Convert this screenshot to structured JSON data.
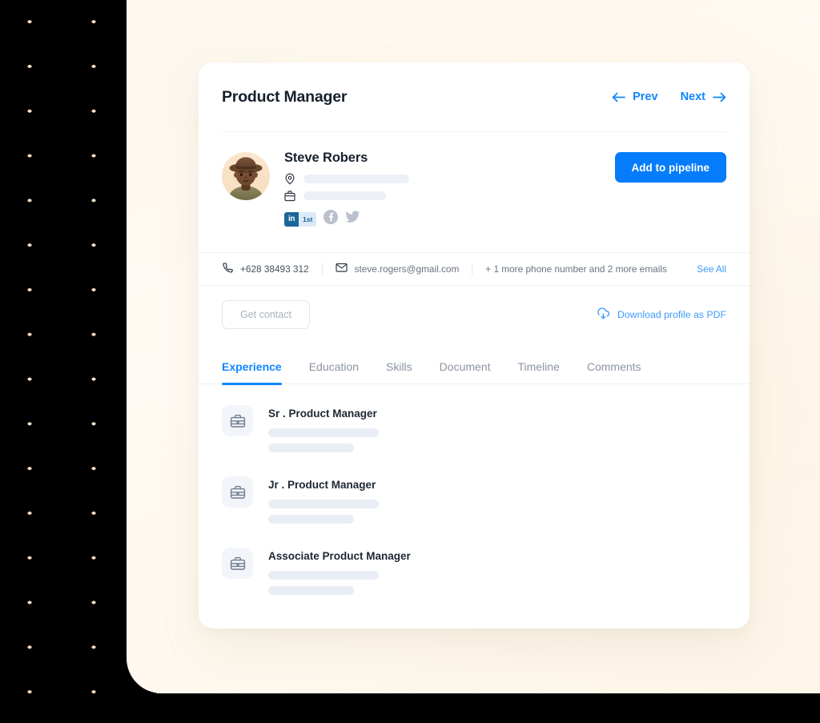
{
  "header": {
    "job_title": "Product Manager",
    "prev_label": "Prev",
    "next_label": "Next"
  },
  "profile": {
    "name": "Steve Robers",
    "avatar_alt": "avatar-illustration",
    "location_placeholder": "",
    "company_placeholder": "",
    "social": {
      "linkedin_mark": "in",
      "linkedin_degree": "1st",
      "facebook": "facebook-icon",
      "twitter": "twitter-icon"
    },
    "add_to_pipeline_label": "Add to pipeline"
  },
  "contact": {
    "phone": "+628 38493 312",
    "email": "steve.rogers@gmail.com",
    "more_info": "+ 1 more phone number and 2 more emails",
    "see_all_label": "See All"
  },
  "actions": {
    "get_contact_label": "Get contact",
    "download_label": "Download profile as PDF"
  },
  "tabs": [
    {
      "label": "Experience",
      "active": true
    },
    {
      "label": "Education",
      "active": false
    },
    {
      "label": "Skills",
      "active": false
    },
    {
      "label": "Document",
      "active": false
    },
    {
      "label": "Timeline",
      "active": false
    },
    {
      "label": "Comments",
      "active": false
    }
  ],
  "experience": [
    {
      "title": "Sr . Product Manager"
    },
    {
      "title": "Jr . Product Manager"
    },
    {
      "title": "Associate Product Manager"
    }
  ],
  "colors": {
    "accent_blue": "#057cfb",
    "link_blue": "#3d9bfd",
    "tab_blue": "#1186fd",
    "linkedin_blue": "#1b6699",
    "cream_frame": "#fdf7ed",
    "dot_peach": "#fadfc9",
    "skeleton": "#e9edf6",
    "backdrop": "#000000"
  }
}
